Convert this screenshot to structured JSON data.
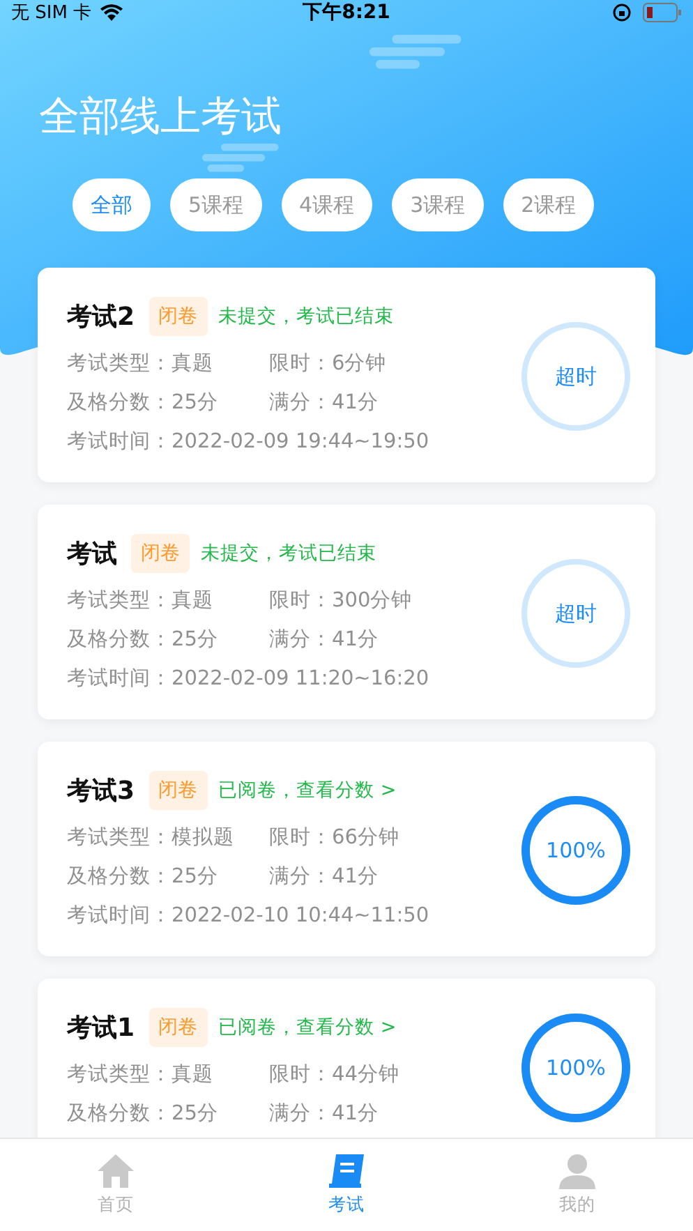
{
  "status_bar": {
    "carrier": "无 SIM 卡",
    "time": "下午8:21"
  },
  "header": {
    "title": "全部线上考试"
  },
  "filters": [
    {
      "label": "全部",
      "selected": true
    },
    {
      "label": "5课程",
      "selected": false
    },
    {
      "label": "4课程",
      "selected": false
    },
    {
      "label": "3课程",
      "selected": false
    },
    {
      "label": "2课程",
      "selected": false
    }
  ],
  "exams": [
    {
      "name": "考试2",
      "tag": "闭卷",
      "status": "未提交，考试已结束",
      "kind": "timeout",
      "ring": "超时",
      "type_label": "考试类型：",
      "type": "真题",
      "limit_label": "限时：",
      "limit": "6分钟",
      "pass_label": "及格分数：",
      "pass": "25分",
      "full_label": "满分：",
      "full": "41分",
      "time_label": "考试时间：",
      "time": "2022-02-09 19:44~19:50"
    },
    {
      "name": "考试",
      "tag": "闭卷",
      "status": "未提交，考试已结束",
      "kind": "timeout",
      "ring": "超时",
      "type_label": "考试类型：",
      "type": "真题",
      "limit_label": "限时：",
      "limit": "300分钟",
      "pass_label": "及格分数：",
      "pass": "25分",
      "full_label": "满分：",
      "full": "41分",
      "time_label": "考试时间：",
      "time": "2022-02-09 11:20~16:20"
    },
    {
      "name": "考试3",
      "tag": "闭卷",
      "status": "已阅卷，查看分数 >",
      "kind": "score",
      "ring": "100%",
      "type_label": "考试类型：",
      "type": "模拟题",
      "limit_label": "限时：",
      "limit": "66分钟",
      "pass_label": "及格分数：",
      "pass": "25分",
      "full_label": "满分：",
      "full": "41分",
      "time_label": "考试时间：",
      "time": "2022-02-10 10:44~11:50"
    },
    {
      "name": "考试1",
      "tag": "闭卷",
      "status": "已阅卷，查看分数 >",
      "kind": "score",
      "ring": "100%",
      "type_label": "考试类型：",
      "type": "真题",
      "limit_label": "限时：",
      "limit": "44分钟",
      "pass_label": "及格分数：",
      "pass": "25分",
      "full_label": "满分：",
      "full": "41分"
    }
  ],
  "tab_bar": [
    {
      "label": "首页",
      "kind": "home",
      "selected": false
    },
    {
      "label": "考试",
      "kind": "exam",
      "selected": true
    },
    {
      "label": "我的",
      "kind": "profile",
      "selected": false
    }
  ]
}
